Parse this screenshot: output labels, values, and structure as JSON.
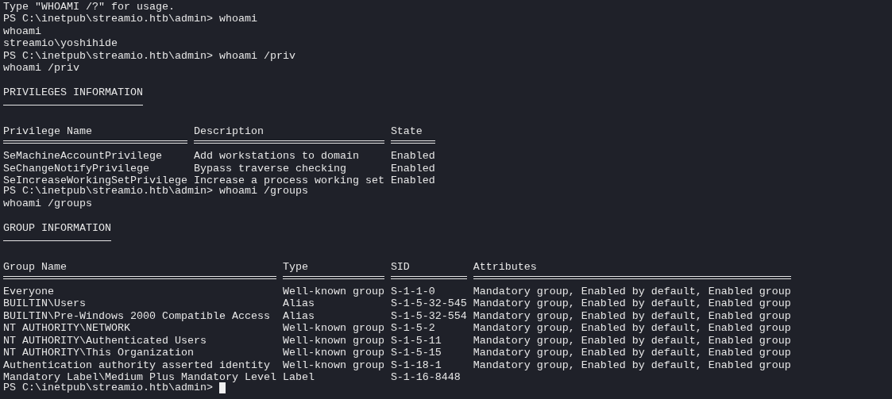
{
  "terminal": {
    "blocks": [
      {
        "kind": "output",
        "text": "Type \"WHOAMI /?\" for usage."
      },
      {
        "kind": "prompt",
        "text": "PS C:\\inetpub\\streamio.htb\\admin> whoami"
      },
      {
        "kind": "output",
        "text": "whoami"
      },
      {
        "kind": "output",
        "text": "streamio\\yoshihide"
      },
      {
        "kind": "prompt",
        "text": "PS C:\\inetpub\\streamio.htb\\admin> whoami /priv"
      },
      {
        "kind": "output",
        "text": "whoami /priv"
      },
      {
        "kind": "heading",
        "text": "PRIVILEGES INFORMATION"
      },
      {
        "kind": "table",
        "columns": [
          "Privilege Name",
          "Description",
          "State"
        ],
        "rows": [
          [
            "SeMachineAccountPrivilege",
            "Add workstations to domain",
            "Enabled"
          ],
          [
            "SeChangeNotifyPrivilege",
            "Bypass traverse checking",
            "Enabled"
          ],
          [
            "SeIncreaseWorkingSetPrivilege",
            "Increase a process working set",
            "Enabled"
          ]
        ]
      },
      {
        "kind": "prompt",
        "text": "PS C:\\inetpub\\streamio.htb\\admin> whoami /groups"
      },
      {
        "kind": "output",
        "text": "whoami /groups"
      },
      {
        "kind": "heading",
        "text": "GROUP INFORMATION"
      },
      {
        "kind": "table",
        "columns": [
          "Group Name",
          "Type",
          "SID",
          "Attributes"
        ],
        "rows": [
          [
            "Everyone",
            "Well-known group",
            "S-1-1-0",
            "Mandatory group, Enabled by default, Enabled group"
          ],
          [
            "BUILTIN\\Users",
            "Alias",
            "S-1-5-32-545",
            "Mandatory group, Enabled by default, Enabled group"
          ],
          [
            "BUILTIN\\Pre-Windows 2000 Compatible Access",
            "Alias",
            "S-1-5-32-554",
            "Mandatory group, Enabled by default, Enabled group"
          ],
          [
            "NT AUTHORITY\\NETWORK",
            "Well-known group",
            "S-1-5-2",
            "Mandatory group, Enabled by default, Enabled group"
          ],
          [
            "NT AUTHORITY\\Authenticated Users",
            "Well-known group",
            "S-1-5-11",
            "Mandatory group, Enabled by default, Enabled group"
          ],
          [
            "NT AUTHORITY\\This Organization",
            "Well-known group",
            "S-1-5-15",
            "Mandatory group, Enabled by default, Enabled group"
          ],
          [
            "Authentication authority asserted identity",
            "Well-known group",
            "S-1-18-1",
            "Mandatory group, Enabled by default, Enabled group"
          ],
          [
            "Mandatory Label\\Medium Plus Mandatory Level",
            "Label",
            "S-1-16-8448"
          ]
        ]
      },
      {
        "kind": "prompt",
        "text": "PS C:\\inetpub\\streamio.htb\\admin>",
        "cursor": true
      }
    ]
  }
}
